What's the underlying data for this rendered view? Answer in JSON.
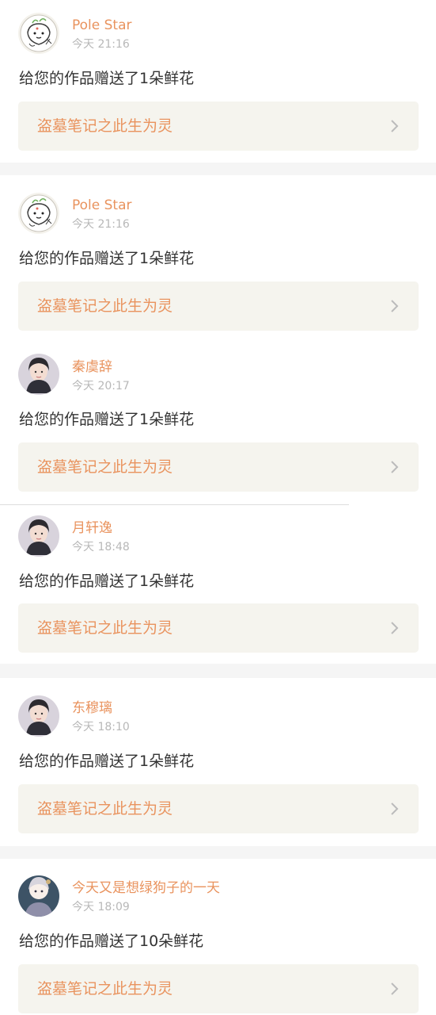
{
  "notifications": [
    {
      "username": "Pole Star",
      "time": "今天 21:16",
      "message": "给您的作品赠送了1朵鲜花",
      "work_title": "盗墓笔记之此生为灵"
    },
    {
      "username": "Pole Star",
      "time": "今天 21:16",
      "message": "给您的作品赠送了1朵鲜花",
      "work_title": "盗墓笔记之此生为灵"
    },
    {
      "username": "秦虞辞",
      "time": "今天 20:17",
      "message": "给您的作品赠送了1朵鲜花",
      "work_title": "盗墓笔记之此生为灵"
    },
    {
      "username": "月轩逸",
      "time": "今天 18:48",
      "message": "给您的作品赠送了1朵鲜花",
      "work_title": "盗墓笔记之此生为灵"
    },
    {
      "username": "东穆璃",
      "time": "今天 18:10",
      "message": "给您的作品赠送了1朵鲜花",
      "work_title": "盗墓笔记之此生为灵"
    },
    {
      "username": "今天又是想绿狗子的一天",
      "time": "今天 18:09",
      "message": "给您的作品赠送了10朵鲜花",
      "work_title": "盗墓笔记之此生为灵"
    }
  ],
  "colors": {
    "username": "#e9935e",
    "time": "#b8b8b8",
    "message": "#333333",
    "work_title": "#e9935e",
    "work_link_bg": "#f5f4ee",
    "divider": "#f5f5f5"
  },
  "icons": {
    "avatar_1": "doodle-avatar-icon",
    "avatar_2": "doodle-avatar-icon",
    "avatar_3": "portrait-avatar-icon",
    "avatar_4": "portrait-avatar-icon",
    "avatar_5": "portrait-avatar-icon",
    "avatar_6": "anime-avatar-icon",
    "link_arrow": "chevron-right-icon"
  }
}
